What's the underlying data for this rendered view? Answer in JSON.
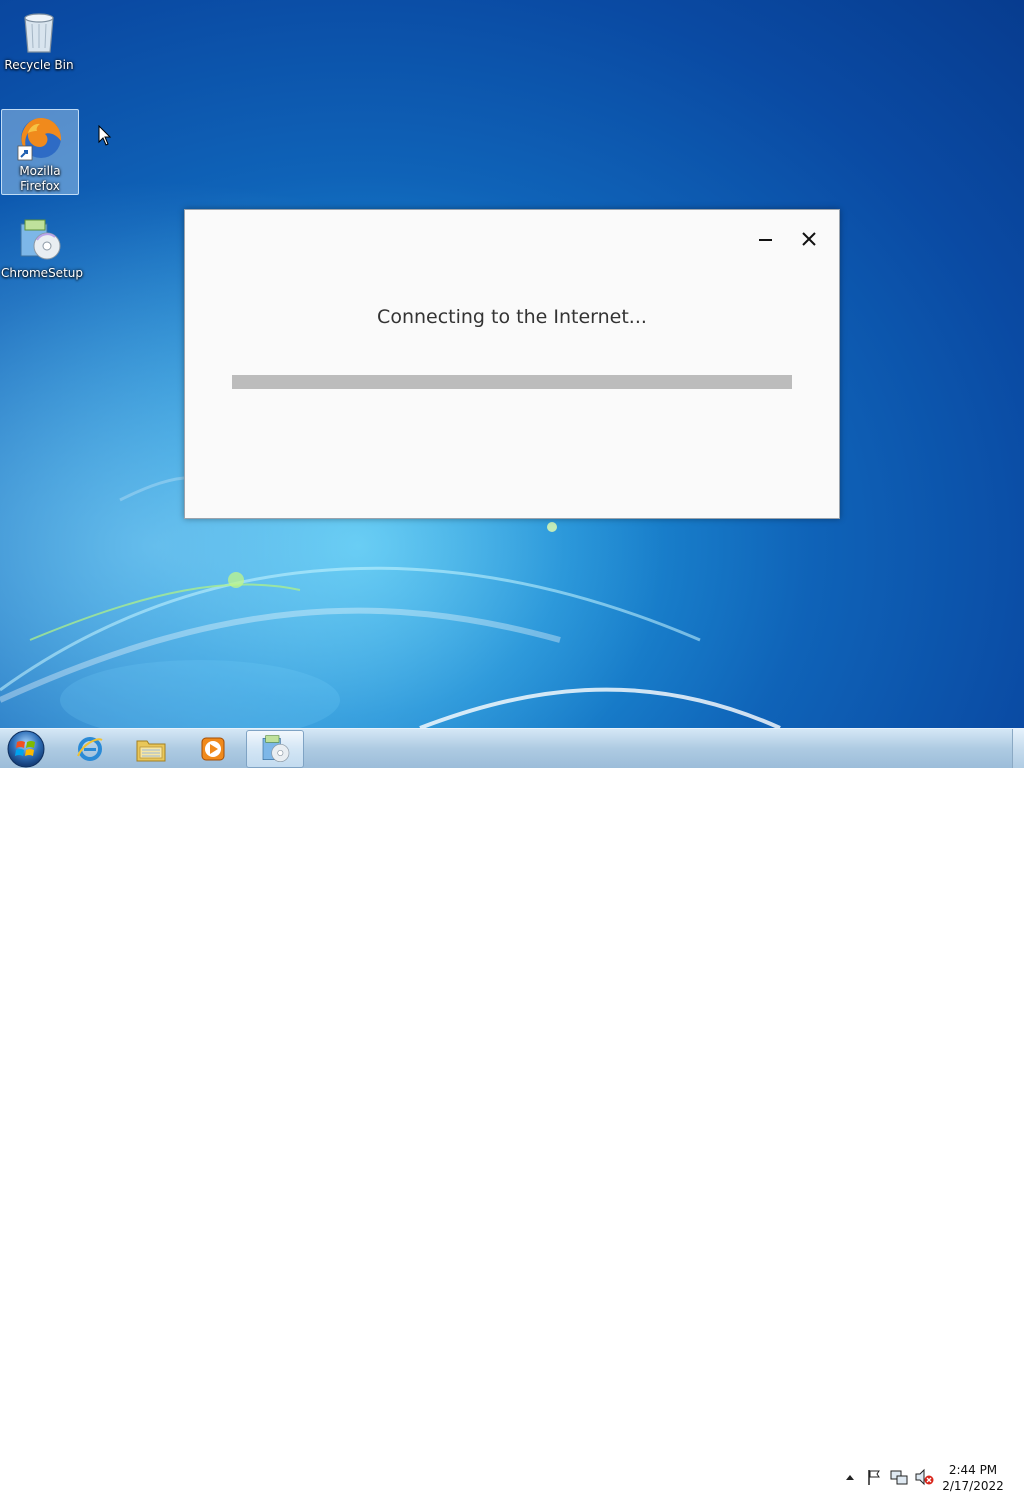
{
  "desktop": {
    "icons": [
      {
        "label": "Recycle Bin",
        "icon": "recycle-bin-icon"
      },
      {
        "label": "Mozilla Firefox",
        "icon": "firefox-icon",
        "selected": true
      },
      {
        "label": "ChromeSetup",
        "icon": "installer-icon"
      }
    ]
  },
  "dialog": {
    "message": "Connecting to the Internet...",
    "progress": 0,
    "minimize_icon": "minimize-icon",
    "close_icon": "close-icon"
  },
  "taskbar": {
    "start_icon": "windows-start-icon",
    "pinned": [
      {
        "name": "Internet Explorer",
        "icon": "internet-explorer-icon"
      },
      {
        "name": "Windows Explorer",
        "icon": "folder-icon"
      },
      {
        "name": "Windows Media Player",
        "icon": "media-player-icon"
      },
      {
        "name": "ChromeSetup",
        "icon": "installer-icon",
        "active": true
      }
    ],
    "tray_icons": [
      "show-hidden-icons-arrow",
      "action-center-flag-icon",
      "network-icon",
      "volume-muted-icon"
    ],
    "clock": {
      "time": "2:44 PM",
      "date": "2/17/2022"
    }
  },
  "colors": {
    "desktop_blue": "#0f63b8",
    "dialog_bg": "#fafafa",
    "progress_track": "#bcbcbc"
  }
}
